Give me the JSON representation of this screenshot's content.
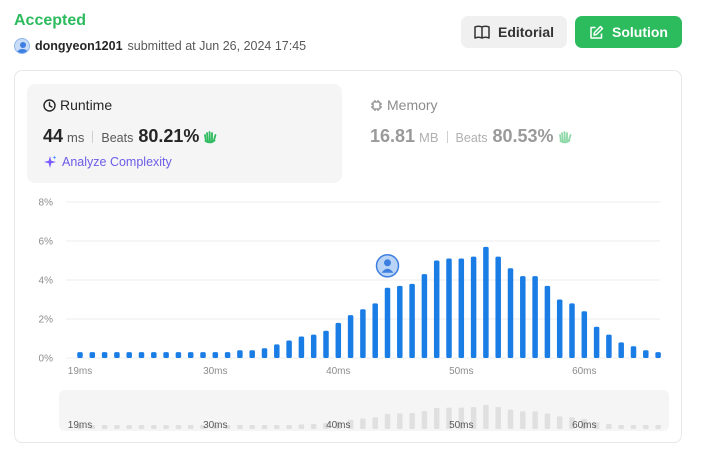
{
  "submission": {
    "status": "Accepted",
    "username": "dongyeon1201",
    "submitted_text": "submitted at Jun 26, 2024 17:45"
  },
  "buttons": {
    "editorial": "Editorial",
    "solution": "Solution"
  },
  "runtime": {
    "title": "Runtime",
    "value": "44",
    "unit": "ms",
    "beats_label": "Beats",
    "beats_value": "80.21%",
    "analyze_label": "Analyze Complexity"
  },
  "memory": {
    "title": "Memory",
    "value": "16.81",
    "unit": "MB",
    "beats_label": "Beats",
    "beats_value": "80.53%"
  },
  "colors": {
    "accent_green": "#2cbb5d",
    "bar_blue": "#1a7de6",
    "mini_bar": "#e0e0e0"
  },
  "chart_data": {
    "type": "bar",
    "xlabel": "",
    "ylabel": "",
    "x": [
      19,
      20,
      21,
      22,
      23,
      24,
      25,
      26,
      27,
      28,
      29,
      30,
      31,
      32,
      33,
      34,
      35,
      36,
      37,
      38,
      39,
      40,
      41,
      42,
      43,
      44,
      45,
      46,
      47,
      48,
      49,
      50,
      51,
      52,
      53,
      54,
      55,
      56,
      57,
      58,
      59,
      60,
      61,
      62,
      63,
      64,
      65,
      66
    ],
    "values": [
      0.3,
      0.3,
      0.3,
      0.3,
      0.3,
      0.3,
      0.3,
      0.3,
      0.3,
      0.3,
      0.3,
      0.3,
      0.3,
      0.4,
      0.4,
      0.5,
      0.7,
      0.9,
      1.1,
      1.2,
      1.4,
      1.8,
      2.2,
      2.5,
      2.8,
      3.6,
      3.7,
      3.8,
      4.3,
      5.0,
      5.1,
      5.1,
      5.2,
      5.7,
      5.2,
      4.6,
      4.2,
      4.2,
      3.7,
      3.0,
      2.8,
      2.4,
      1.6,
      1.2,
      0.8,
      0.6,
      0.4,
      0.3
    ],
    "y_ticks": [
      "0%",
      "2%",
      "4%",
      "6%",
      "8%"
    ],
    "ylim": [
      0,
      8
    ],
    "x_ticks": [
      {
        "x": 19,
        "label": "19ms"
      },
      {
        "x": 30,
        "label": "30ms"
      },
      {
        "x": 40,
        "label": "40ms"
      },
      {
        "x": 50,
        "label": "50ms"
      },
      {
        "x": 60,
        "label": "60ms"
      }
    ],
    "highlight_x": 44,
    "grid": true
  }
}
